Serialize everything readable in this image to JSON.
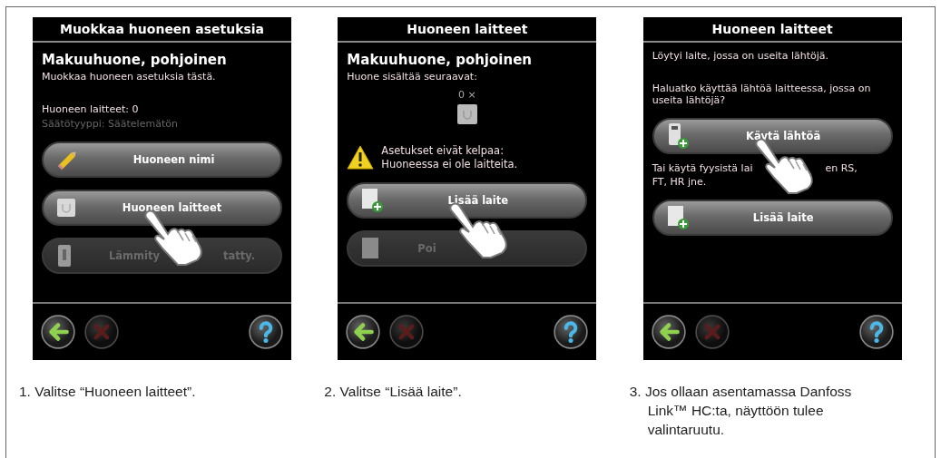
{
  "screens": [
    {
      "title": "Muokkaa huoneen asetuksia",
      "items": [
        {
          "kind": "heading",
          "text": "Makuuhuone, pohjoinen"
        },
        {
          "kind": "text",
          "text": "Muokkaa huoneen asetuksia tästä."
        },
        {
          "kind": "info",
          "text": "Huoneen laitteet: 0"
        },
        {
          "kind": "dim",
          "text": "Säätötyyppi: Säätelemätön"
        },
        {
          "kind": "button",
          "label_parts": [
            "Huoneen nimi"
          ],
          "disabled": false,
          "pointer": false
        },
        {
          "kind": "button",
          "label_parts": [
            "Huoneen laitteet"
          ],
          "disabled": false,
          "pointer": true
        },
        {
          "kind": "button",
          "label_parts": [
            "Lämmity",
            "tatty."
          ],
          "disabled": true,
          "pointer": false
        }
      ],
      "bottom_buttons": [
        {
          "kind": "back",
          "disabled": false
        },
        {
          "kind": "cancel",
          "disabled": true
        },
        {
          "kind": "help",
          "disabled": false
        }
      ]
    },
    {
      "title": "Huoneen laitteet",
      "items": [
        {
          "kind": "heading",
          "text": "Makuuhuone, pohjoinen"
        },
        {
          "kind": "text",
          "text": "Huone sisältää seuraavat:"
        },
        {
          "kind": "count",
          "text": "0 ×"
        },
        {
          "kind": "warning",
          "lines": [
            "Asetukset eivät kelpaa:",
            "Huoneessa ei ole laitteita."
          ]
        },
        {
          "kind": "button",
          "label_parts": [
            "Lisää laite"
          ],
          "disabled": false,
          "pointer": true
        },
        {
          "kind": "button",
          "label_parts": [
            "Poi"
          ],
          "disabled": true,
          "pointer": false
        }
      ],
      "bottom_buttons": [
        {
          "kind": "back",
          "disabled": false
        },
        {
          "kind": "cancel",
          "disabled": true
        },
        {
          "kind": "help",
          "disabled": false
        }
      ]
    },
    {
      "title": "Huoneen laitteet",
      "items": [
        {
          "kind": "text",
          "text": "Löytyi laite, jossa on useita lähtöjä."
        },
        {
          "kind": "info",
          "text": "Haluatko käyttää lähtöä laitteessa, jossa on useita lähtöjä?"
        },
        {
          "kind": "button",
          "label_parts": [
            "Käytä lähtöä"
          ],
          "disabled": false,
          "pointer": true
        },
        {
          "kind": "covered_text",
          "lines": [
            [
              "Tai käytä fyysistä lai",
              "en RS,"
            ],
            [
              "FT, HR jne."
            ]
          ]
        },
        {
          "kind": "button",
          "label_parts": [
            "Lisää laite"
          ],
          "disabled": false,
          "pointer": false
        }
      ],
      "bottom_buttons": [
        {
          "kind": "back",
          "disabled": false
        },
        {
          "kind": "cancel",
          "disabled": true
        },
        {
          "kind": "help",
          "disabled": false
        }
      ]
    }
  ],
  "captions": [
    {
      "number": "1.",
      "text": "Valitse “Huoneen laitteet”."
    },
    {
      "number": "2.",
      "text": "Valitse “Lisää laite”."
    },
    {
      "number": "3.",
      "text": "Jos ollaan asentamassa Danfoss Link™ HC:ta, näyttöön tulee valintaruutu."
    }
  ]
}
